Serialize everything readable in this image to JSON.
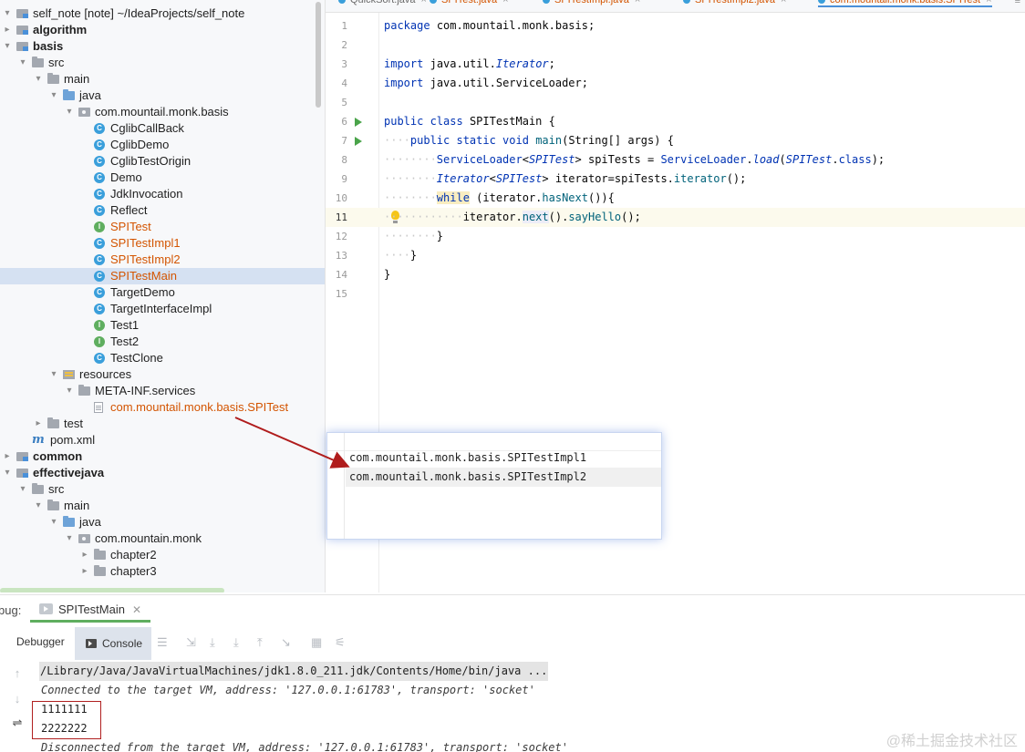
{
  "tree": {
    "rows": [
      {
        "label": "self_note [note] ~/IdeaProjects/self_note",
        "depth": 0,
        "arrow": "▾",
        "icon": "module-folder-icon",
        "style": ""
      },
      {
        "label": "algorithm",
        "depth": 0,
        "arrow": "▸",
        "icon": "module-folder-icon",
        "style": "bold"
      },
      {
        "label": "basis",
        "depth": 0,
        "arrow": "▾",
        "icon": "module-folder-icon",
        "style": "bold"
      },
      {
        "label": "src",
        "depth": 1,
        "arrow": "▾",
        "icon": "folder-icon",
        "style": ""
      },
      {
        "label": "main",
        "depth": 2,
        "arrow": "▾",
        "icon": "folder-icon",
        "style": ""
      },
      {
        "label": "java",
        "depth": 3,
        "arrow": "▾",
        "icon": "source-folder-icon",
        "style": ""
      },
      {
        "label": "com.mountail.monk.basis",
        "depth": 4,
        "arrow": "▾",
        "icon": "package-icon",
        "style": ""
      },
      {
        "label": "CglibCallBack",
        "depth": 5,
        "arrow": "",
        "icon": "class-icon",
        "style": ""
      },
      {
        "label": "CglibDemo",
        "depth": 5,
        "arrow": "",
        "icon": "class-icon",
        "style": ""
      },
      {
        "label": "CglibTestOrigin",
        "depth": 5,
        "arrow": "",
        "icon": "class-icon",
        "style": ""
      },
      {
        "label": "Demo",
        "depth": 5,
        "arrow": "",
        "icon": "class-icon",
        "style": ""
      },
      {
        "label": "JdkInvocation",
        "depth": 5,
        "arrow": "",
        "icon": "class-icon",
        "style": ""
      },
      {
        "label": "Reflect",
        "depth": 5,
        "arrow": "",
        "icon": "class-icon",
        "style": ""
      },
      {
        "label": "SPITest",
        "depth": 5,
        "arrow": "",
        "icon": "interface-icon",
        "style": "orange"
      },
      {
        "label": "SPITestImpl1",
        "depth": 5,
        "arrow": "",
        "icon": "class-icon",
        "style": "orange"
      },
      {
        "label": "SPITestImpl2",
        "depth": 5,
        "arrow": "",
        "icon": "class-icon",
        "style": "orange"
      },
      {
        "label": "SPITestMain",
        "depth": 5,
        "arrow": "",
        "icon": "class-icon",
        "style": "orange",
        "selected": true
      },
      {
        "label": "TargetDemo",
        "depth": 5,
        "arrow": "",
        "icon": "class-icon",
        "style": ""
      },
      {
        "label": "TargetInterfaceImpl",
        "depth": 5,
        "arrow": "",
        "icon": "class-icon",
        "style": ""
      },
      {
        "label": "Test1",
        "depth": 5,
        "arrow": "",
        "icon": "interface-icon",
        "style": ""
      },
      {
        "label": "Test2",
        "depth": 5,
        "arrow": "",
        "icon": "interface-icon",
        "style": ""
      },
      {
        "label": "TestClone",
        "depth": 5,
        "arrow": "",
        "icon": "class-icon",
        "style": ""
      },
      {
        "label": "resources",
        "depth": 3,
        "arrow": "▾",
        "icon": "resources-folder-icon",
        "style": ""
      },
      {
        "label": "META-INF.services",
        "depth": 4,
        "arrow": "▾",
        "icon": "folder-icon",
        "style": ""
      },
      {
        "label": "com.mountail.monk.basis.SPITest",
        "depth": 5,
        "arrow": "",
        "icon": "text-file-icon",
        "style": "orange"
      },
      {
        "label": "test",
        "depth": 2,
        "arrow": "▸",
        "icon": "folder-icon",
        "style": ""
      },
      {
        "label": "pom.xml",
        "depth": 1,
        "arrow": "",
        "icon": "maven-icon",
        "style": ""
      },
      {
        "label": "common",
        "depth": 0,
        "arrow": "▸",
        "icon": "module-folder-icon",
        "style": "bold"
      },
      {
        "label": "effectivejava",
        "depth": 0,
        "arrow": "▾",
        "icon": "module-folder-icon",
        "style": "bold"
      },
      {
        "label": "src",
        "depth": 1,
        "arrow": "▾",
        "icon": "folder-icon",
        "style": ""
      },
      {
        "label": "main",
        "depth": 2,
        "arrow": "▾",
        "icon": "folder-icon",
        "style": ""
      },
      {
        "label": "java",
        "depth": 3,
        "arrow": "▾",
        "icon": "source-folder-icon",
        "style": ""
      },
      {
        "label": "com.mountain.monk",
        "depth": 4,
        "arrow": "▾",
        "icon": "package-icon",
        "style": ""
      },
      {
        "label": "chapter2",
        "depth": 5,
        "arrow": "▸",
        "icon": "folder-icon",
        "style": ""
      },
      {
        "label": "chapter3",
        "depth": 5,
        "arrow": "▸",
        "icon": "folder-icon",
        "style": ""
      }
    ]
  },
  "editor": {
    "tabs": [
      {
        "label": "QuickSort.java",
        "style": ""
      },
      {
        "label": "SPITest.java",
        "style": "orange"
      },
      {
        "label": "SPITestImpl.java",
        "style": "orange"
      },
      {
        "label": "SPITestImpl2.java",
        "style": "orange"
      },
      {
        "label": "com.mountail.monk.basis.SPITest",
        "style": "active"
      }
    ],
    "tabs_more": "≡",
    "lines": [
      {
        "n": "1",
        "run": false,
        "bulb": false,
        "current": false,
        "html": "<span class='kw'>package</span> <span class='plain'>com.mountail.monk.basis;</span>"
      },
      {
        "n": "2",
        "run": false,
        "bulb": false,
        "current": false,
        "html": ""
      },
      {
        "n": "3",
        "run": false,
        "bulb": false,
        "current": false,
        "html": "<span class='kw'>import</span> <span class='plain'>java.util.</span><span class='itb'>Iterator</span><span class='plain'>;</span>"
      },
      {
        "n": "4",
        "run": false,
        "bulb": false,
        "current": false,
        "html": "<span class='kw'>import</span> <span class='plain'>java.util.ServiceLoader;</span>"
      },
      {
        "n": "5",
        "run": false,
        "bulb": false,
        "current": false,
        "html": ""
      },
      {
        "n": "6",
        "run": true,
        "bulb": false,
        "current": false,
        "html": "<span class='kw'>public class</span> <span class='plain'>SPITestMain {</span>"
      },
      {
        "n": "7",
        "run": true,
        "bulb": false,
        "current": false,
        "html": "<span class='ws'>····</span><span class='kw'>public static void</span> <span class='fn'>main</span><span class='plain'>(String[] args) {</span>"
      },
      {
        "n": "8",
        "run": false,
        "bulb": false,
        "current": false,
        "html": "<span class='ws'>········</span><span class='ty'>ServiceLoader</span><span class='plain'>&lt;</span><span class='itb'>SPITest</span><span class='plain'>&gt; spiTests = </span><span class='ty'>ServiceLoader</span><span class='plain'>.</span><span class='itb'>load</span><span class='plain'>(</span><span class='itb'>SPITest</span><span class='plain'>.</span><span class='kw'>class</span><span class='plain'>);</span>"
      },
      {
        "n": "9",
        "run": false,
        "bulb": false,
        "current": false,
        "html": "<span class='ws'>········</span><span class='itb'>Iterator</span><span class='plain'>&lt;</span><span class='itb'>SPITest</span><span class='plain'>&gt; iterator=spiTests.</span><span class='fn'>iterator</span><span class='plain'>();</span>"
      },
      {
        "n": "10",
        "run": false,
        "bulb": false,
        "current": false,
        "html": "<span class='ws'>········</span><span class='kw hlw'>while</span> <span class='plain'>(iterator.</span><span class='fn'>hasNext</span><span class='plain'>()){</span>"
      },
      {
        "n": "11",
        "run": false,
        "bulb": true,
        "current": true,
        "html": "<span class='ws'>············</span><span class='plain'>iterator.</span><span class='fn hln'>next</span><span class='plain'>().</span><span class='fn'>sayHello</span><span class='plain'>();</span>"
      },
      {
        "n": "12",
        "run": false,
        "bulb": false,
        "current": false,
        "html": "<span class='ws'>········</span><span class='plain'>}</span>"
      },
      {
        "n": "13",
        "run": false,
        "bulb": false,
        "current": false,
        "html": "<span class='ws'>····</span><span class='plain'>}</span>"
      },
      {
        "n": "14",
        "run": false,
        "bulb": false,
        "current": false,
        "html": "<span class='plain'>}</span>"
      },
      {
        "n": "15",
        "run": false,
        "bulb": false,
        "current": false,
        "html": ""
      }
    ]
  },
  "popup": {
    "lines": [
      "com.mountail.monk.basis.SPITestImpl1",
      "com.mountail.monk.basis.SPITestImpl2"
    ]
  },
  "annotation": {
    "arrow_color": "#b01c1c"
  },
  "debug": {
    "label": "bug:",
    "session_tab": "SPITestMain",
    "debugger_tab": "Debugger",
    "console_tab": "Console",
    "toolbar_icons": [
      "list-icon",
      "restore-icon",
      "step-over-icon",
      "step-into-icon",
      "step-out-icon",
      "run-to-cursor-icon",
      "table-icon",
      "settings-icon"
    ],
    "console": {
      "command": "/Library/Java/JavaVirtualMachines/jdk1.8.0_211.jdk/Contents/Home/bin/java ...",
      "connected": "Connected to the target VM, address: '127.0.0.1:61783', transport: 'socket'",
      "output": [
        "1111111",
        "2222222"
      ],
      "disconnected": "Disconnected from the target VM, address: '127.0.0.1:61783', transport: 'socket'"
    },
    "watermark": "@稀土掘金技术社区"
  },
  "colors": {
    "selection": "#d5e1f2",
    "accent": "#4a90d9",
    "highlight_box": "#b02020"
  }
}
